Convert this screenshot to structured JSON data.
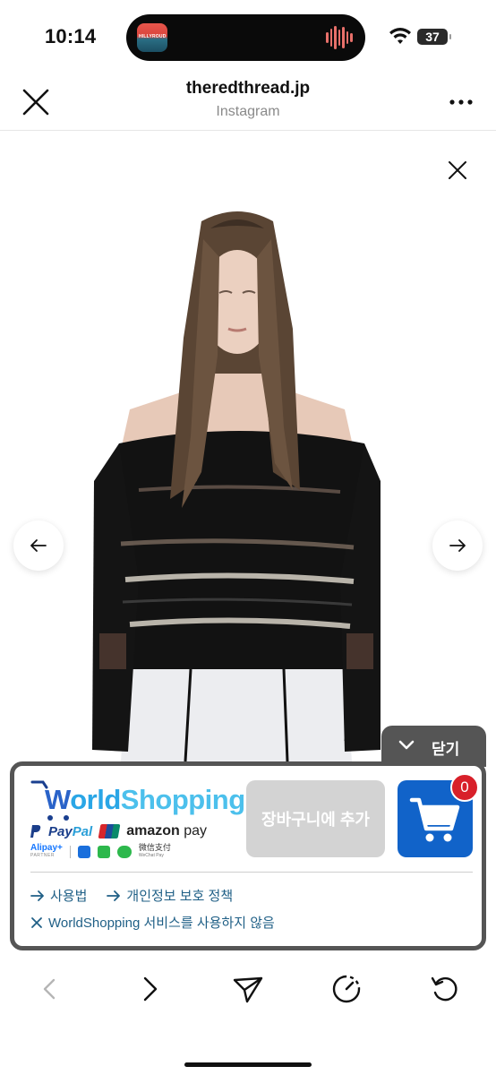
{
  "status_bar": {
    "time": "10:14",
    "battery": "37",
    "island_app_label": "HILLYROUD"
  },
  "header": {
    "title": "theredthread.jp",
    "subtitle": "Instagram"
  },
  "content": {
    "image_alt": "Model wearing black off-shoulder knit sweater with striped pattern"
  },
  "close_tab": {
    "label": "닫기"
  },
  "worldshopping": {
    "logo_w": "W",
    "logo_rest": "orld",
    "logo_shop": "Shopping",
    "paypal_a": "Pay",
    "paypal_b": "Pal",
    "amazon_a": "amazon",
    "amazon_b": " pay",
    "alipay": "Alipay+",
    "alipay_sub": "PARTNER",
    "wechat": "微信支付",
    "wechat_sub": "WeChat Pay",
    "add_to_cart_label": "장바구니에 추가",
    "cart_count": "0",
    "link_howto": "사용법",
    "link_privacy": "개인정보 보호 정책",
    "optout": "WorldShopping 서비스를 사용하지 않음"
  },
  "colors": {
    "accent_blue": "#1163c9",
    "panel_border": "#555555",
    "badge_red": "#d8202a",
    "link_color": "#1f5f86"
  }
}
